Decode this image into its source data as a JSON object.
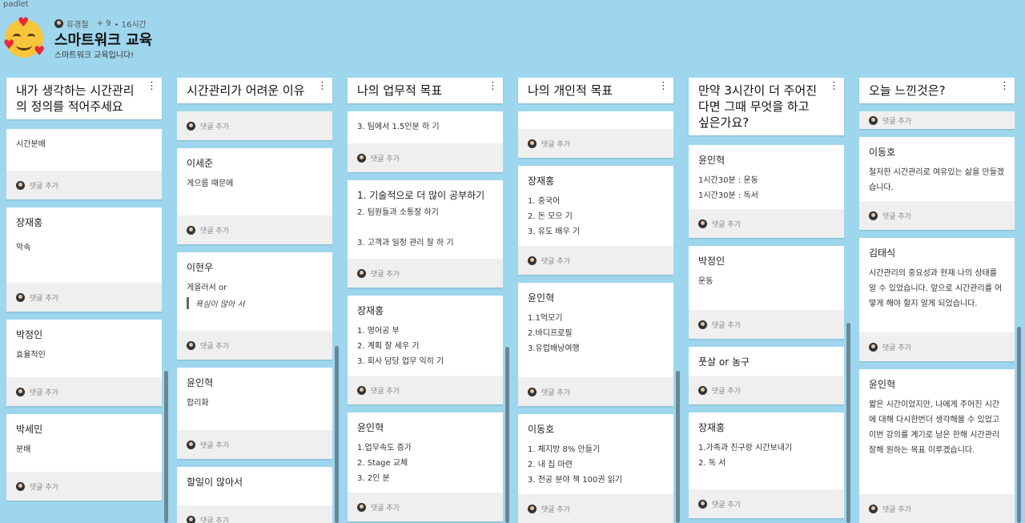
{
  "app": {
    "brand": "padlet"
  },
  "header": {
    "author": "유경철",
    "likes": "+ 9",
    "time": "• 16시간",
    "title": "스마트워크 교육",
    "subtitle": "스마트워크 교육입니다!"
  },
  "comment_label": "댓글 추가",
  "columns": [
    {
      "title": "내가 생각하는 시간관리의 정의를 적어주세요",
      "cards": [
        {
          "author": "",
          "text": "시간분배"
        },
        {
          "author": "장재홍",
          "text": "악속"
        },
        {
          "author": "박정인",
          "text": "효율적인"
        },
        {
          "author": "박세민",
          "text": "분배"
        }
      ]
    },
    {
      "title": "시간관리가 어려운 이유",
      "cards": [
        {
          "author": "이세준",
          "text": "게으름 때문에"
        },
        {
          "author": "이현우",
          "text": "게을러서 or",
          "quote": "욕심이 많아 서"
        },
        {
          "author": "윤인혁",
          "text": "합리화"
        },
        {
          "author": "할일이 많아서",
          "text": ""
        }
      ]
    },
    {
      "title": "나의 업무적 목표",
      "partial": "3. 팀에서 1.5인분 하 기",
      "cards": [
        {
          "author": "1. 기술적으로 더 많이 공부하기",
          "text": "2. 팀원들과 소통잘 하기\n\n3. 고객과 일정 관리 잘 하 기"
        },
        {
          "author": "장재홍",
          "text": "1. 영어공 부\n2.  계획 잘 세우 기\n3. 회사 담당 업무 익히 기"
        },
        {
          "author": "윤인혁",
          "text": "1.업무속도 증가\n2.  Stage 교체\n3. 2인 분"
        }
      ]
    },
    {
      "title": "나의 개인적 목표",
      "cards": [
        {
          "author": "장재홍",
          "text": "1.  중국어\n2.  돈 모으 기\n3. 유도 배우 기"
        },
        {
          "author": "윤인혁",
          "text": "1.1억모기\n2.바디프로필\n3.유럽배낭여행"
        },
        {
          "author": "이동호",
          "text": "1. 체지방 8% 만들기\n2. 내 집 마련\n3. 전공 분야 책 100권 읽기"
        }
      ]
    },
    {
      "title": "만약 3시간이 더 주어진다면 그때 무엇을 하고 싶은가요?",
      "cards": [
        {
          "author": "윤인혁",
          "text": "1시간30분 : 운동\n1시간30분 : 독서"
        },
        {
          "author": "박정인",
          "text": "운동"
        },
        {
          "author": "풋살 or 농구",
          "text": ""
        },
        {
          "author": "장재홍",
          "text": "1.가족과 친구랑 시간보내기\n2. 독 서"
        }
      ]
    },
    {
      "title": "오늘 느낀것은?",
      "cards": [
        {
          "author": "이동호",
          "text": "철저한 시간관리로 여유있는 삶을 만들겠습니다."
        },
        {
          "author": "김태식",
          "text": "시간관리의 중요성과 현재 나의 상태를 알 수 있었습니다. 앞으로 시간관리를 어떻게  해야 할지 알게 되었습니다."
        },
        {
          "author": "윤인혁",
          "text": "짧은 시간이었지만, 나에게 주어진 시간에 대해 다시한번더 생각해볼 수 있었고\n이번 강의를 계기로 남은 한해 시간관리 잘해 원하는 목표 이루겠습니다."
        }
      ]
    }
  ]
}
